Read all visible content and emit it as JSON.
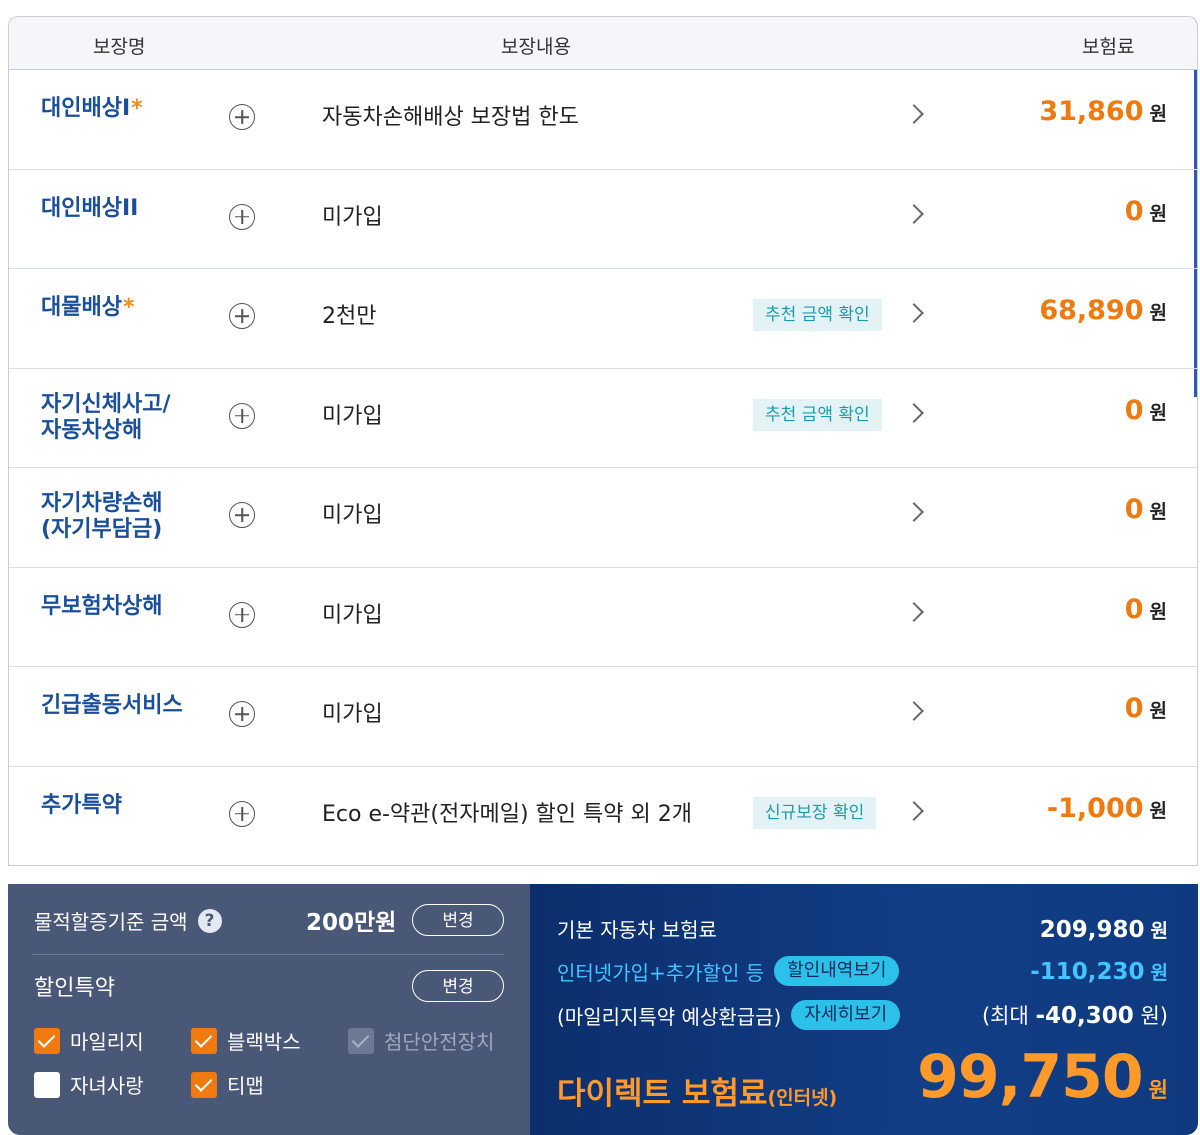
{
  "header": {
    "name": "보장명",
    "content": "보장내용",
    "premium": "보험료"
  },
  "rows": [
    {
      "name1": "대인배상I",
      "name2": "",
      "required": "*",
      "content": "자동차손해배상 보장법 한도",
      "tag": "",
      "amount": "31,860",
      "unit": "원"
    },
    {
      "name1": "대인배상II",
      "name2": "",
      "required": "",
      "content": "미가입",
      "tag": "",
      "amount": "0",
      "unit": "원"
    },
    {
      "name1": "대물배상",
      "name2": "",
      "required": "*",
      "content": "2천만",
      "tag": "추천 금액 확인",
      "amount": "68,890",
      "unit": "원"
    },
    {
      "name1": "자기신체사고/",
      "name2": "자동차상해",
      "required": "",
      "content": "미가입",
      "tag": "추천 금액 확인",
      "amount": "0",
      "unit": "원"
    },
    {
      "name1": "자기차량손해",
      "name2": "(자기부담금)",
      "required": "",
      "content": "미가입",
      "tag": "",
      "amount": "0",
      "unit": "원"
    },
    {
      "name1": "무보험차상해",
      "name2": "",
      "required": "",
      "content": "미가입",
      "tag": "",
      "amount": "0",
      "unit": "원"
    },
    {
      "name1": "긴급출동서비스",
      "name2": "",
      "required": "",
      "content": "미가입",
      "tag": "",
      "amount": "0",
      "unit": "원"
    },
    {
      "name1": "추가특약",
      "name2": "",
      "required": "",
      "content": "Eco e-약관(전자메일) 할인 특약 외 2개",
      "tag": "신규보장 확인",
      "amount": "-1,000",
      "unit": "원"
    }
  ],
  "left_panel": {
    "threshold_label": "물적할증기준 금액",
    "threshold_value": "200만원",
    "change_label": "변경",
    "discount_label": "할인특약",
    "options": [
      {
        "label": "마일리지",
        "checked": true,
        "disabled": false
      },
      {
        "label": "블랙박스",
        "checked": true,
        "disabled": false
      },
      {
        "label": "첨단안전장치",
        "checked": true,
        "disabled": true
      },
      {
        "label": "자녀사랑",
        "checked": false,
        "disabled": false
      },
      {
        "label": "티맵",
        "checked": true,
        "disabled": false
      }
    ]
  },
  "right_panel": {
    "base_label": "기본 자동차 보험료",
    "base_value": "209,980",
    "discount_label": "인터넷가입+추가할인 등",
    "discount_button": "할인내역보기",
    "discount_value": "-110,230",
    "mileage_label": "(마일리지특약 예상환급금)",
    "mileage_button": "자세히보기",
    "mileage_prefix": "(최대",
    "mileage_value": "-40,300",
    "mileage_suffix": "원)",
    "direct_label": "다이렉트 보험료",
    "direct_suffix": "(인터넷)",
    "total_value": "99,750",
    "unit": "원"
  },
  "colors": {
    "accent_orange": "#f07a10",
    "name_blue": "#1a4f9c",
    "teal_tag": "#1f9aaa",
    "panel_gray": "#4a5878",
    "panel_navy": "#0c2e6c"
  },
  "icons": {
    "expand": "plus-circle-icon",
    "detail": "chevron-right-icon",
    "help": "question-circle-icon",
    "check": "checkbox-icon"
  }
}
